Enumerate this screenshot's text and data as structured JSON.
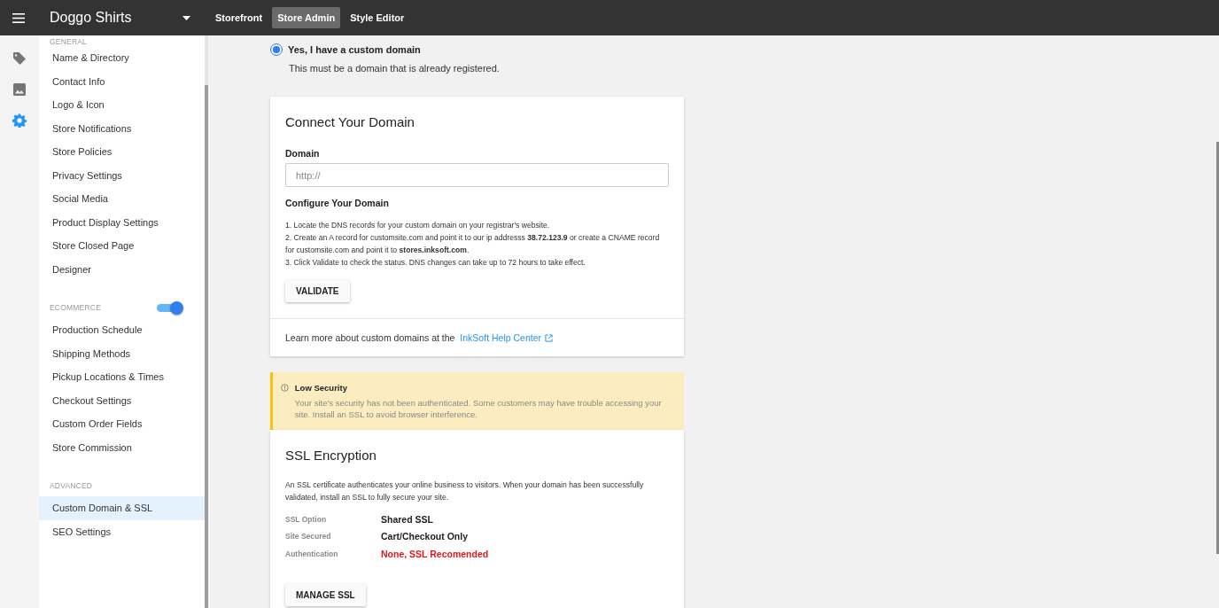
{
  "topbar": {
    "store_name": "Doggo Shirts",
    "tabs": [
      {
        "label": "Storefront",
        "selected": false
      },
      {
        "label": "Store Admin",
        "selected": true
      },
      {
        "label": "Style Editor",
        "selected": false
      }
    ]
  },
  "rail": [
    {
      "kind": "tag",
      "selected": false
    },
    {
      "kind": "image",
      "selected": false
    },
    {
      "kind": "settings",
      "selected": true
    }
  ],
  "sidebar": {
    "groups": [
      {
        "heading": "GENERAL",
        "items": [
          {
            "label": "Name & Directory",
            "selected": false
          },
          {
            "label": "Contact Info",
            "selected": false
          },
          {
            "label": "Logo & Icon",
            "selected": false
          },
          {
            "label": "Store Notifications",
            "selected": false
          },
          {
            "label": "Store Policies",
            "selected": false
          },
          {
            "label": "Privacy Settings",
            "selected": false
          },
          {
            "label": "Social Media",
            "selected": false
          },
          {
            "label": "Product Display Settings",
            "selected": false
          },
          {
            "label": "Store Closed Page",
            "selected": false
          },
          {
            "label": "Designer",
            "selected": false
          }
        ]
      },
      {
        "heading": "ECOMMERCE",
        "toggle": {
          "on": true
        },
        "items": [
          {
            "label": "Production Schedule",
            "selected": false
          },
          {
            "label": "Shipping Methods",
            "selected": false
          },
          {
            "label": "Pickup Locations & Times",
            "selected": false
          },
          {
            "label": "Checkout Settings",
            "selected": false
          },
          {
            "label": "Custom Order Fields",
            "selected": false
          },
          {
            "label": "Store Commission",
            "selected": false
          }
        ]
      },
      {
        "heading": "ADVANCED",
        "items": [
          {
            "label": "Custom Domain & SSL",
            "selected": true
          },
          {
            "label": "SEO Settings",
            "selected": false
          }
        ]
      }
    ]
  },
  "domain_option": {
    "label": "Yes, I have a custom domain",
    "selected": true,
    "hint": "This must be a domain that is already registered."
  },
  "connect_card": {
    "title": "Connect Your Domain",
    "field_label": "Domain",
    "placeholder": "http://",
    "configure_heading": "Configure Your Domain",
    "steps": [
      "1. Locate the DNS records for your custom domain on your registrar's website.",
      "2. Create an A record for customsite.com and point it to our ip addresss **38.72.123.9** or create a CNAME record for customsite.com and point it to **stores.inksoft.com**.",
      "3. Click Validate to check the status. DNS changes can take up to 72 hours to take effect."
    ],
    "button": "VALIDATE",
    "footer_text": "Learn more about custom domains at the ",
    "footer_link": "InkSoft Help Center"
  },
  "alert": {
    "kind": "warning",
    "title": "Low Security",
    "message": "Your site's security has not been authenticated. Some customers may have trouble accessing your site. Install an SSL to avoid browser interference."
  },
  "ssl_card": {
    "title": "SSL Encryption",
    "description": "An SSL certificate authenticates your online business to visitors. When your domain has been successfully validated, install an SSL to fully secure your site.",
    "details": [
      {
        "label": "SSL Option",
        "value": "Shared SSL",
        "color": "#222222"
      },
      {
        "label": "Site Secured",
        "value": "Cart/Checkout Only",
        "color": "#222222"
      },
      {
        "label": "Authentication",
        "value": "None, SSL Recomended",
        "color": "#e8141a"
      }
    ],
    "button": "MANAGE SSL"
  }
}
